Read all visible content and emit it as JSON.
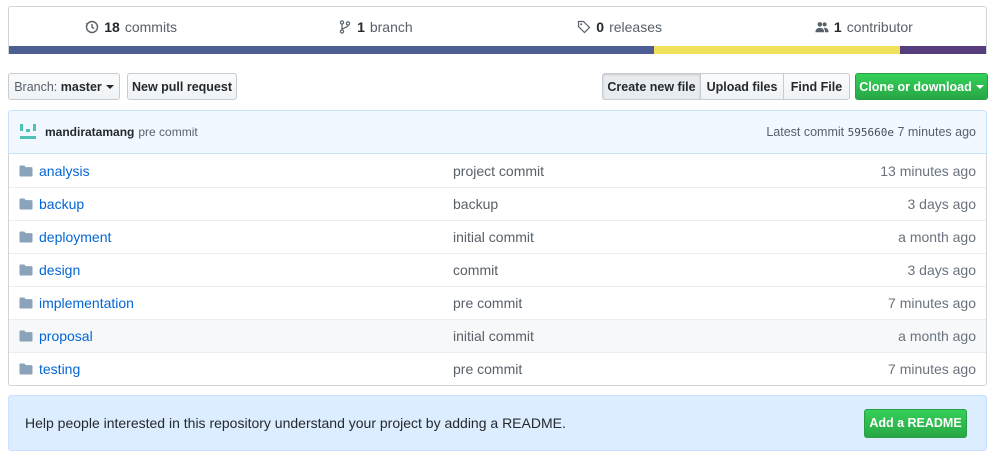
{
  "summary": {
    "commits_count": "18",
    "commits_label": "commits",
    "branch_count": "1",
    "branch_label": "branch",
    "releases_count": "0",
    "releases_label": "releases",
    "contributor_count": "1",
    "contributor_label": "contributor"
  },
  "language_bar": [
    {
      "color": "#4F5D95",
      "percent": 66.0
    },
    {
      "color": "#F1E05A",
      "percent": 25.2
    },
    {
      "color": "#563D7C",
      "percent": 8.8
    }
  ],
  "toolbar": {
    "branch_prefix": "Branch:",
    "branch_name": "master",
    "new_pull_request": "New pull request",
    "create_new_file": "Create new file",
    "upload_files": "Upload files",
    "find_file": "Find File",
    "clone_or_download": "Clone or download"
  },
  "latest_commit": {
    "author": "mandiratamang",
    "message": "pre commit",
    "label": "Latest commit",
    "sha": "595660e",
    "time": "7 minutes ago"
  },
  "files": [
    {
      "name": "analysis",
      "message": "project commit",
      "age": "13 minutes ago"
    },
    {
      "name": "backup",
      "message": "backup",
      "age": "3 days ago"
    },
    {
      "name": "deployment",
      "message": "initial commit",
      "age": "a month ago"
    },
    {
      "name": "design",
      "message": "commit",
      "age": "3 days ago"
    },
    {
      "name": "implementation",
      "message": "pre commit",
      "age": "7 minutes ago"
    },
    {
      "name": "proposal",
      "message": "initial commit",
      "age": "a month ago"
    },
    {
      "name": "testing",
      "message": "pre commit",
      "age": "7 minutes ago"
    }
  ],
  "readme_banner": {
    "text": "Help people interested in this repository understand your project by adding a README.",
    "button": "Add a README"
  },
  "icons": {
    "commits": "history-icon",
    "branch": "git-branch-icon",
    "releases": "tag-icon",
    "contributor": "people-icon",
    "folder": "folder-icon"
  },
  "colors": {
    "link": "#0366d6",
    "green": "#28a745",
    "tease_bg": "#f1f8ff",
    "banner_bg": "#dbedff"
  }
}
